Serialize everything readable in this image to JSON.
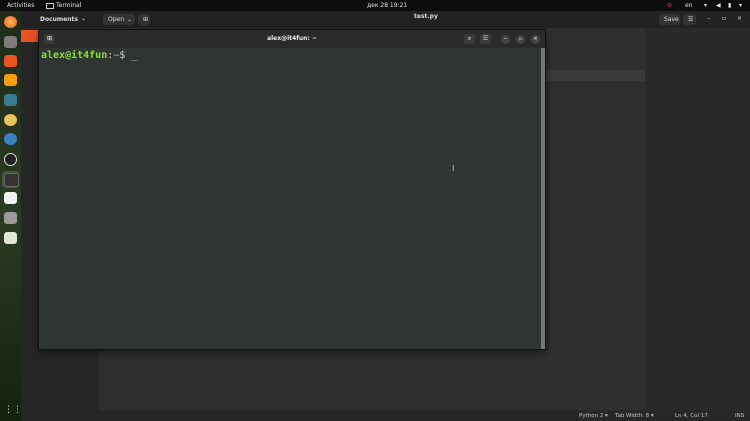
{
  "topbar": {
    "activities": "Activities",
    "app": "Terminal",
    "clock": "дек 28  19:21",
    "lang": "en"
  },
  "dock": {
    "icons": [
      "firefox-icon",
      "files-icon",
      "ubuntu-software-icon",
      "sublime-icon",
      "image-viewer-icon",
      "gimp-icon",
      "thunderbird-icon",
      "clock-icon",
      "terminal-icon",
      "text-editor-icon",
      "disk-icon",
      "recycle-icon",
      "show-apps-icon"
    ]
  },
  "editor": {
    "sidebar_title": "Documents",
    "open_label": "Open",
    "file_title": "test.py",
    "save_label": "Save"
  },
  "terminal": {
    "title": "alex@it4fun: ~",
    "prompt_user": "alex@it4fun",
    "prompt_sep": ":",
    "prompt_path": "~",
    "prompt_symbol": "$ _"
  },
  "statusbar": {
    "language": "Python 2 ▾",
    "tab_width": "Tab Width: 8 ▾",
    "position": "Ln 4, Col 17",
    "mode": "INS"
  }
}
